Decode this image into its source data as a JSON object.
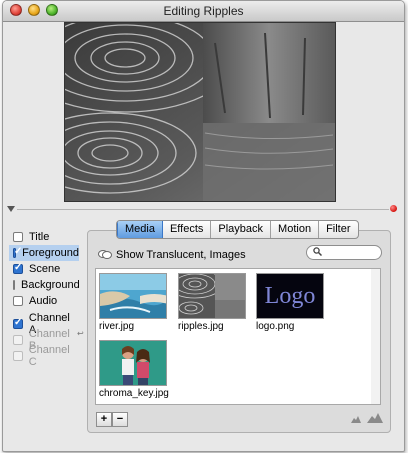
{
  "window": {
    "title": "Editing Ripples"
  },
  "left_options": [
    {
      "label": "Title",
      "checked": false,
      "selected": false,
      "enabled": true
    },
    {
      "label": "Foreground",
      "checked": true,
      "selected": true,
      "enabled": true
    },
    {
      "label": "Scene",
      "checked": true,
      "selected": false,
      "enabled": true
    },
    {
      "label": "Background",
      "checked": false,
      "selected": false,
      "enabled": true
    },
    {
      "label": "Audio",
      "checked": false,
      "selected": false,
      "enabled": true
    },
    {
      "label": "Channel A",
      "checked": true,
      "selected": false,
      "enabled": true
    },
    {
      "label": "Channel B",
      "checked": false,
      "selected": false,
      "enabled": false
    },
    {
      "label": "Channel C",
      "checked": false,
      "selected": false,
      "enabled": false
    }
  ],
  "tabs": [
    {
      "label": "Media",
      "active": true
    },
    {
      "label": "Effects",
      "active": false
    },
    {
      "label": "Playback",
      "active": false
    },
    {
      "label": "Motion",
      "active": false
    },
    {
      "label": "Filter",
      "active": false
    }
  ],
  "media": {
    "show_label": "Show Translucent, Images",
    "search": {
      "value": "",
      "placeholder": ""
    },
    "items": [
      {
        "name": "river.jpg"
      },
      {
        "name": "ripples.jpg"
      },
      {
        "name": "logo.png",
        "text": "Logo"
      },
      {
        "name": "chroma_key.jpg"
      }
    ]
  },
  "buttons": {
    "add": "+",
    "remove": "−"
  },
  "colors": {
    "selection": "#b5d0ef",
    "tab_active": "#6fa7e4",
    "alert": "#d4120d"
  }
}
